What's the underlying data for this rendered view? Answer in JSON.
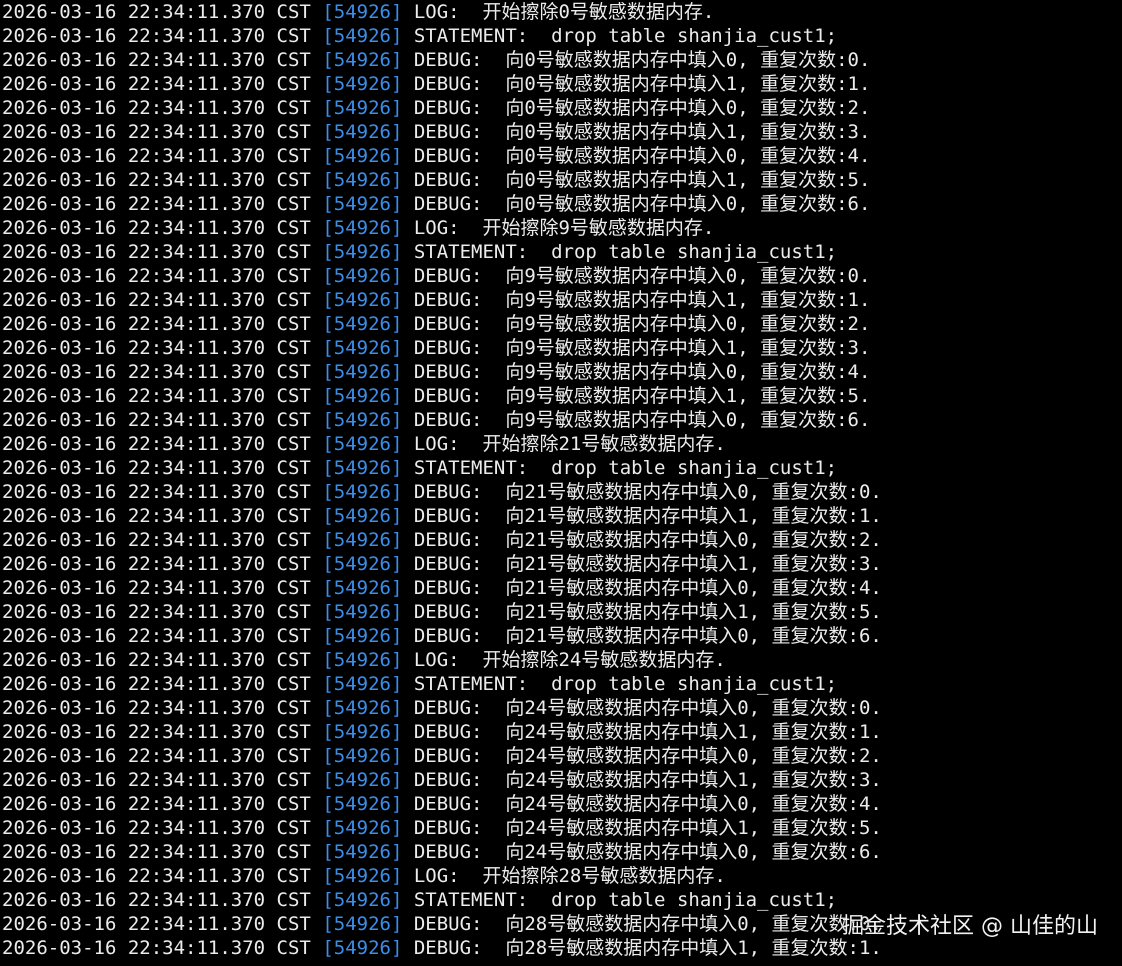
{
  "terminal": {
    "background": "#000000",
    "text_color": "#ececec",
    "pid_color": "#3b8eea",
    "lines": [
      {
        "ts": "2026-03-16 22:34:11.370 CST",
        "pid": "[54926]",
        "msg": "LOG:  开始擦除0号敏感数据内存."
      },
      {
        "ts": "2026-03-16 22:34:11.370 CST",
        "pid": "[54926]",
        "msg": "STATEMENT:  drop table shanjia_cust1;"
      },
      {
        "ts": "2026-03-16 22:34:11.370 CST",
        "pid": "[54926]",
        "msg": "DEBUG:  向0号敏感数据内存中填入0, 重复次数:0."
      },
      {
        "ts": "2026-03-16 22:34:11.370 CST",
        "pid": "[54926]",
        "msg": "DEBUG:  向0号敏感数据内存中填入1, 重复次数:1."
      },
      {
        "ts": "2026-03-16 22:34:11.370 CST",
        "pid": "[54926]",
        "msg": "DEBUG:  向0号敏感数据内存中填入0, 重复次数:2."
      },
      {
        "ts": "2026-03-16 22:34:11.370 CST",
        "pid": "[54926]",
        "msg": "DEBUG:  向0号敏感数据内存中填入1, 重复次数:3."
      },
      {
        "ts": "2026-03-16 22:34:11.370 CST",
        "pid": "[54926]",
        "msg": "DEBUG:  向0号敏感数据内存中填入0, 重复次数:4."
      },
      {
        "ts": "2026-03-16 22:34:11.370 CST",
        "pid": "[54926]",
        "msg": "DEBUG:  向0号敏感数据内存中填入1, 重复次数:5."
      },
      {
        "ts": "2026-03-16 22:34:11.370 CST",
        "pid": "[54926]",
        "msg": "DEBUG:  向0号敏感数据内存中填入0, 重复次数:6."
      },
      {
        "ts": "2026-03-16 22:34:11.370 CST",
        "pid": "[54926]",
        "msg": "LOG:  开始擦除9号敏感数据内存."
      },
      {
        "ts": "2026-03-16 22:34:11.370 CST",
        "pid": "[54926]",
        "msg": "STATEMENT:  drop table shanjia_cust1;"
      },
      {
        "ts": "2026-03-16 22:34:11.370 CST",
        "pid": "[54926]",
        "msg": "DEBUG:  向9号敏感数据内存中填入0, 重复次数:0."
      },
      {
        "ts": "2026-03-16 22:34:11.370 CST",
        "pid": "[54926]",
        "msg": "DEBUG:  向9号敏感数据内存中填入1, 重复次数:1."
      },
      {
        "ts": "2026-03-16 22:34:11.370 CST",
        "pid": "[54926]",
        "msg": "DEBUG:  向9号敏感数据内存中填入0, 重复次数:2."
      },
      {
        "ts": "2026-03-16 22:34:11.370 CST",
        "pid": "[54926]",
        "msg": "DEBUG:  向9号敏感数据内存中填入1, 重复次数:3."
      },
      {
        "ts": "2026-03-16 22:34:11.370 CST",
        "pid": "[54926]",
        "msg": "DEBUG:  向9号敏感数据内存中填入0, 重复次数:4."
      },
      {
        "ts": "2026-03-16 22:34:11.370 CST",
        "pid": "[54926]",
        "msg": "DEBUG:  向9号敏感数据内存中填入1, 重复次数:5."
      },
      {
        "ts": "2026-03-16 22:34:11.370 CST",
        "pid": "[54926]",
        "msg": "DEBUG:  向9号敏感数据内存中填入0, 重复次数:6."
      },
      {
        "ts": "2026-03-16 22:34:11.370 CST",
        "pid": "[54926]",
        "msg": "LOG:  开始擦除21号敏感数据内存."
      },
      {
        "ts": "2026-03-16 22:34:11.370 CST",
        "pid": "[54926]",
        "msg": "STATEMENT:  drop table shanjia_cust1;"
      },
      {
        "ts": "2026-03-16 22:34:11.370 CST",
        "pid": "[54926]",
        "msg": "DEBUG:  向21号敏感数据内存中填入0, 重复次数:0."
      },
      {
        "ts": "2026-03-16 22:34:11.370 CST",
        "pid": "[54926]",
        "msg": "DEBUG:  向21号敏感数据内存中填入1, 重复次数:1."
      },
      {
        "ts": "2026-03-16 22:34:11.370 CST",
        "pid": "[54926]",
        "msg": "DEBUG:  向21号敏感数据内存中填入0, 重复次数:2."
      },
      {
        "ts": "2026-03-16 22:34:11.370 CST",
        "pid": "[54926]",
        "msg": "DEBUG:  向21号敏感数据内存中填入1, 重复次数:3."
      },
      {
        "ts": "2026-03-16 22:34:11.370 CST",
        "pid": "[54926]",
        "msg": "DEBUG:  向21号敏感数据内存中填入0, 重复次数:4."
      },
      {
        "ts": "2026-03-16 22:34:11.370 CST",
        "pid": "[54926]",
        "msg": "DEBUG:  向21号敏感数据内存中填入1, 重复次数:5."
      },
      {
        "ts": "2026-03-16 22:34:11.370 CST",
        "pid": "[54926]",
        "msg": "DEBUG:  向21号敏感数据内存中填入0, 重复次数:6."
      },
      {
        "ts": "2026-03-16 22:34:11.370 CST",
        "pid": "[54926]",
        "msg": "LOG:  开始擦除24号敏感数据内存."
      },
      {
        "ts": "2026-03-16 22:34:11.370 CST",
        "pid": "[54926]",
        "msg": "STATEMENT:  drop table shanjia_cust1;"
      },
      {
        "ts": "2026-03-16 22:34:11.370 CST",
        "pid": "[54926]",
        "msg": "DEBUG:  向24号敏感数据内存中填入0, 重复次数:0."
      },
      {
        "ts": "2026-03-16 22:34:11.370 CST",
        "pid": "[54926]",
        "msg": "DEBUG:  向24号敏感数据内存中填入1, 重复次数:1."
      },
      {
        "ts": "2026-03-16 22:34:11.370 CST",
        "pid": "[54926]",
        "msg": "DEBUG:  向24号敏感数据内存中填入0, 重复次数:2."
      },
      {
        "ts": "2026-03-16 22:34:11.370 CST",
        "pid": "[54926]",
        "msg": "DEBUG:  向24号敏感数据内存中填入1, 重复次数:3."
      },
      {
        "ts": "2026-03-16 22:34:11.370 CST",
        "pid": "[54926]",
        "msg": "DEBUG:  向24号敏感数据内存中填入0, 重复次数:4."
      },
      {
        "ts": "2026-03-16 22:34:11.370 CST",
        "pid": "[54926]",
        "msg": "DEBUG:  向24号敏感数据内存中填入1, 重复次数:5."
      },
      {
        "ts": "2026-03-16 22:34:11.370 CST",
        "pid": "[54926]",
        "msg": "DEBUG:  向24号敏感数据内存中填入0, 重复次数:6."
      },
      {
        "ts": "2026-03-16 22:34:11.370 CST",
        "pid": "[54926]",
        "msg": "LOG:  开始擦除28号敏感数据内存."
      },
      {
        "ts": "2026-03-16 22:34:11.370 CST",
        "pid": "[54926]",
        "msg": "STATEMENT:  drop table shanjia_cust1;"
      },
      {
        "ts": "2026-03-16 22:34:11.370 CST",
        "pid": "[54926]",
        "msg": "DEBUG:  向28号敏感数据内存中填入0, 重复次数:0."
      },
      {
        "ts": "2026-03-16 22:34:11.370 CST",
        "pid": "[54926]",
        "msg": "DEBUG:  向28号敏感数据内存中填入1, 重复次数:1."
      }
    ]
  },
  "watermark": {
    "text": "掘金技术社区 @ 山佳的山"
  }
}
